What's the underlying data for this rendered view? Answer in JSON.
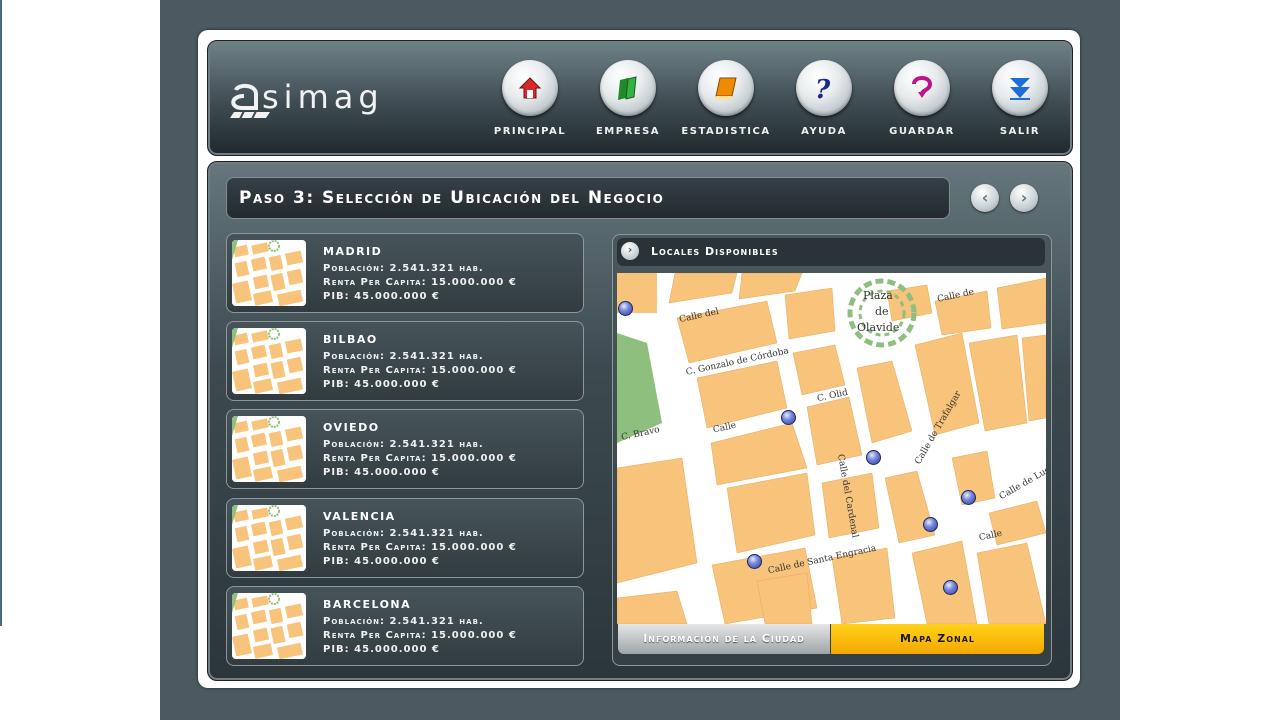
{
  "app": {
    "logo_text": "simag",
    "logo_initial": "a"
  },
  "nav": [
    {
      "label": "PRINCIPAL",
      "icon": "home-icon",
      "color": "#d42a2a"
    },
    {
      "label": "EMPRESA",
      "icon": "books-icon",
      "color": "#1f8a2a"
    },
    {
      "label": "ESTADISTICA",
      "icon": "chart-book-icon",
      "color": "#f08a00"
    },
    {
      "label": "AYUDA",
      "icon": "help-icon",
      "color": "#1a2a8a"
    },
    {
      "label": "GUARDAR",
      "icon": "save-icon",
      "color": "#c0108a"
    },
    {
      "label": "SALIR",
      "icon": "exit-icon",
      "color": "#1e6ed8"
    }
  ],
  "step": {
    "title": "Paso 3: Selección de Ubicación del Negocio"
  },
  "cities": [
    {
      "name": "MADRID",
      "poblacion": "Población: 2.541.321 hab.",
      "renta": "Renta Per Capita: 15.000.000 €",
      "pib": "PIB: 45.000.000 €"
    },
    {
      "name": "BILBAO",
      "poblacion": "Población: 2.541.321 hab.",
      "renta": "Renta Per Capita: 15.000.000 €",
      "pib": "PIB: 45.000.000 €"
    },
    {
      "name": "OVIEDO",
      "poblacion": "Población: 2.541.321 hab.",
      "renta": "Renta Per Capita: 15.000.000 €",
      "pib": "PIB: 45.000.000 €"
    },
    {
      "name": "VALENCIA",
      "poblacion": "Población: 2.541.321 hab.",
      "renta": "Renta Per Capita: 15.000.000 €",
      "pib": "PIB: 45.000.000 €"
    },
    {
      "name": "BARCELONA",
      "poblacion": "Población: 2.541.321 hab.",
      "renta": "Renta Per Capita: 15.000.000 €",
      "pib": "PIB: 45.000.000 €"
    }
  ],
  "map": {
    "title": "Locales Disponibles",
    "streets": [
      "Plaza",
      "de",
      "Olavide",
      "Calle del",
      "Calle de",
      "C. Gonzalo de Córdoba",
      "Calle de Trafalgar",
      "Calle",
      "Calle del Cardenal",
      "Calle de Luchana",
      "C. Olid",
      "Calle de Santa Engracia",
      "C. Bravo",
      "Calle"
    ],
    "tabs": {
      "info": "Información de la Ciudad",
      "map": "Mapa Zonal"
    }
  },
  "colors": {
    "accent_yellow": "#f4a800",
    "block": "#f8c37a",
    "park": "#8fbf7f",
    "pin": "#3d50b0"
  }
}
